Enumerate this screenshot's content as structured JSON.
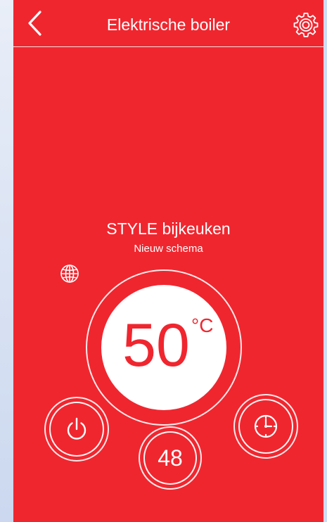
{
  "header": {
    "title": "Elektrische boiler",
    "back_icon": "chevron-left-icon",
    "settings_icon": "gear-icon"
  },
  "device": {
    "name": "STYLE bijkeuken",
    "schedule": "Nieuw schema",
    "globe_icon": "globe-icon"
  },
  "temperature": {
    "value": "50",
    "unit": "°C"
  },
  "controls": {
    "power_icon": "power-icon",
    "schedule_icon": "clock-icon",
    "setpoint_value": "48"
  },
  "colors": {
    "accent": "#f0262f",
    "foreground": "#ffffff",
    "outer_frame": "#d2def3"
  }
}
